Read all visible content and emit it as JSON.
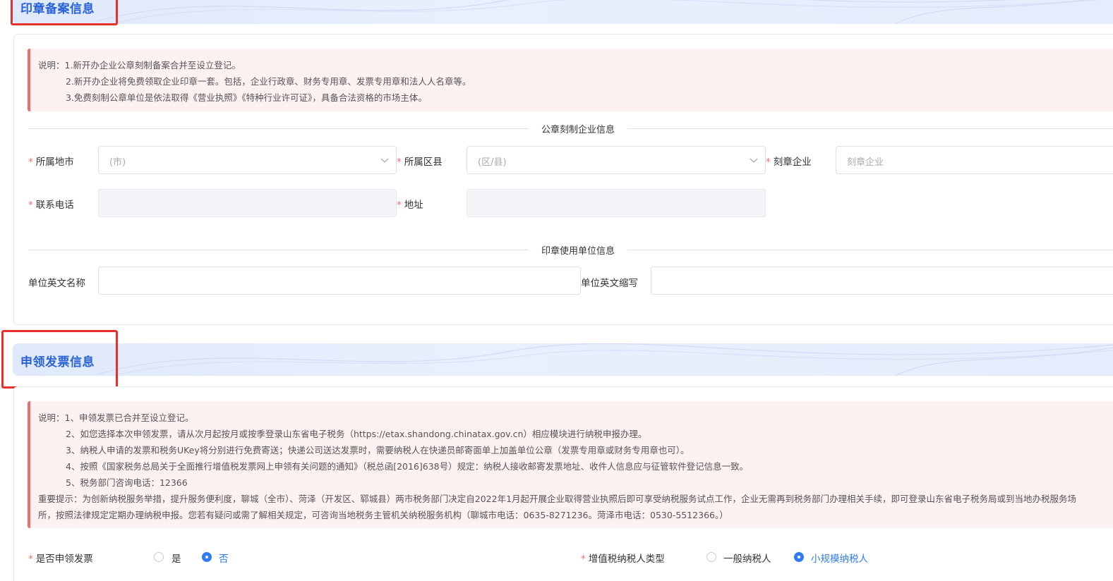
{
  "seal_section": {
    "title": "印章备案信息",
    "notes": [
      "说明：1.新开办企业公章刻制备案合并至设立登记。",
      "2.新开办企业将免费领取企业印章一套。包括，企业行政章、财务专用章、发票专用章和法人人名章等。",
      "3.免费刻制公章单位是依法取得《营业执照》《特种行业许可证》，具备合法资格的市场主体。"
    ],
    "engraving_divider": "公章刻制企业信息",
    "city_label": "所属地市",
    "city_placeholder": "(市)",
    "district_label": "所属区县",
    "district_placeholder": "(区/县)",
    "engraver_label": "刻章企业",
    "engraver_placeholder": "刻章企业",
    "phone_label": "联系电话",
    "address_label": "地址",
    "unit_divider": "印章使用单位信息",
    "english_name_label": "单位英文名称",
    "english_abbr_label": "单位英文缩写"
  },
  "invoice_section": {
    "title": "申领发票信息",
    "notes": [
      "说明：1、申领发票已合并至设立登记。",
      "2、如您选择本次申领发票，请从次月起按月或按季登录山东省电子税务（https://etax.shandong.chinatax.gov.cn）相应模块进行纳税申报办理。",
      "3、纳税人申请的发票和税务UKey将分别进行免费寄送；快递公司送达发票时，需要纳税人在快递员邮寄面单上加盖单位公章（发票专用章或财务专用章也可）。",
      "4、按照《国家税务总局关于全面推行增值税发票网上申领有关问题的通知》（税总函[2016]638号）规定：纳税人接收邮寄发票地址、收件人信息应与征管软件登记信息一致。",
      "5、税务部门咨询电话：12366",
      "重要提示：为创新纳税服务举措，提升服务便利度，聊城（全市）、菏泽（开发区、郓城县）两市税务部门决定自2022年1月起开展企业取得营业执照后即可享受纳税服务试点工作，企业无需再到税务部门办理相关手续，即可登录山东省电子税务局或到当地办税服务场",
      "所，按照法律规定定期办理纳税申报。您若有疑问或需了解相关规定，可咨询当地税务主管机关纳税服务机构（聊城市电话：0635-8271236。菏泽市电话：0530-5512366。）"
    ],
    "apply_label": "是否申领发票",
    "apply_options": [
      "是",
      "否"
    ],
    "apply_selected": "否",
    "taxpayer_label": "增值税纳税人类型",
    "taxpayer_options": [
      "一般纳税人",
      "小规模纳税人"
    ],
    "taxpayer_selected": "小规模纳税人"
  },
  "colors": {
    "title_blue": "#2a63d6",
    "highlight_red": "#e8302a",
    "notice_bg": "#fef1f1",
    "notice_border": "#f06c6c",
    "radio_blue": "#2f7bf6",
    "required_star": "#f56c6c"
  }
}
